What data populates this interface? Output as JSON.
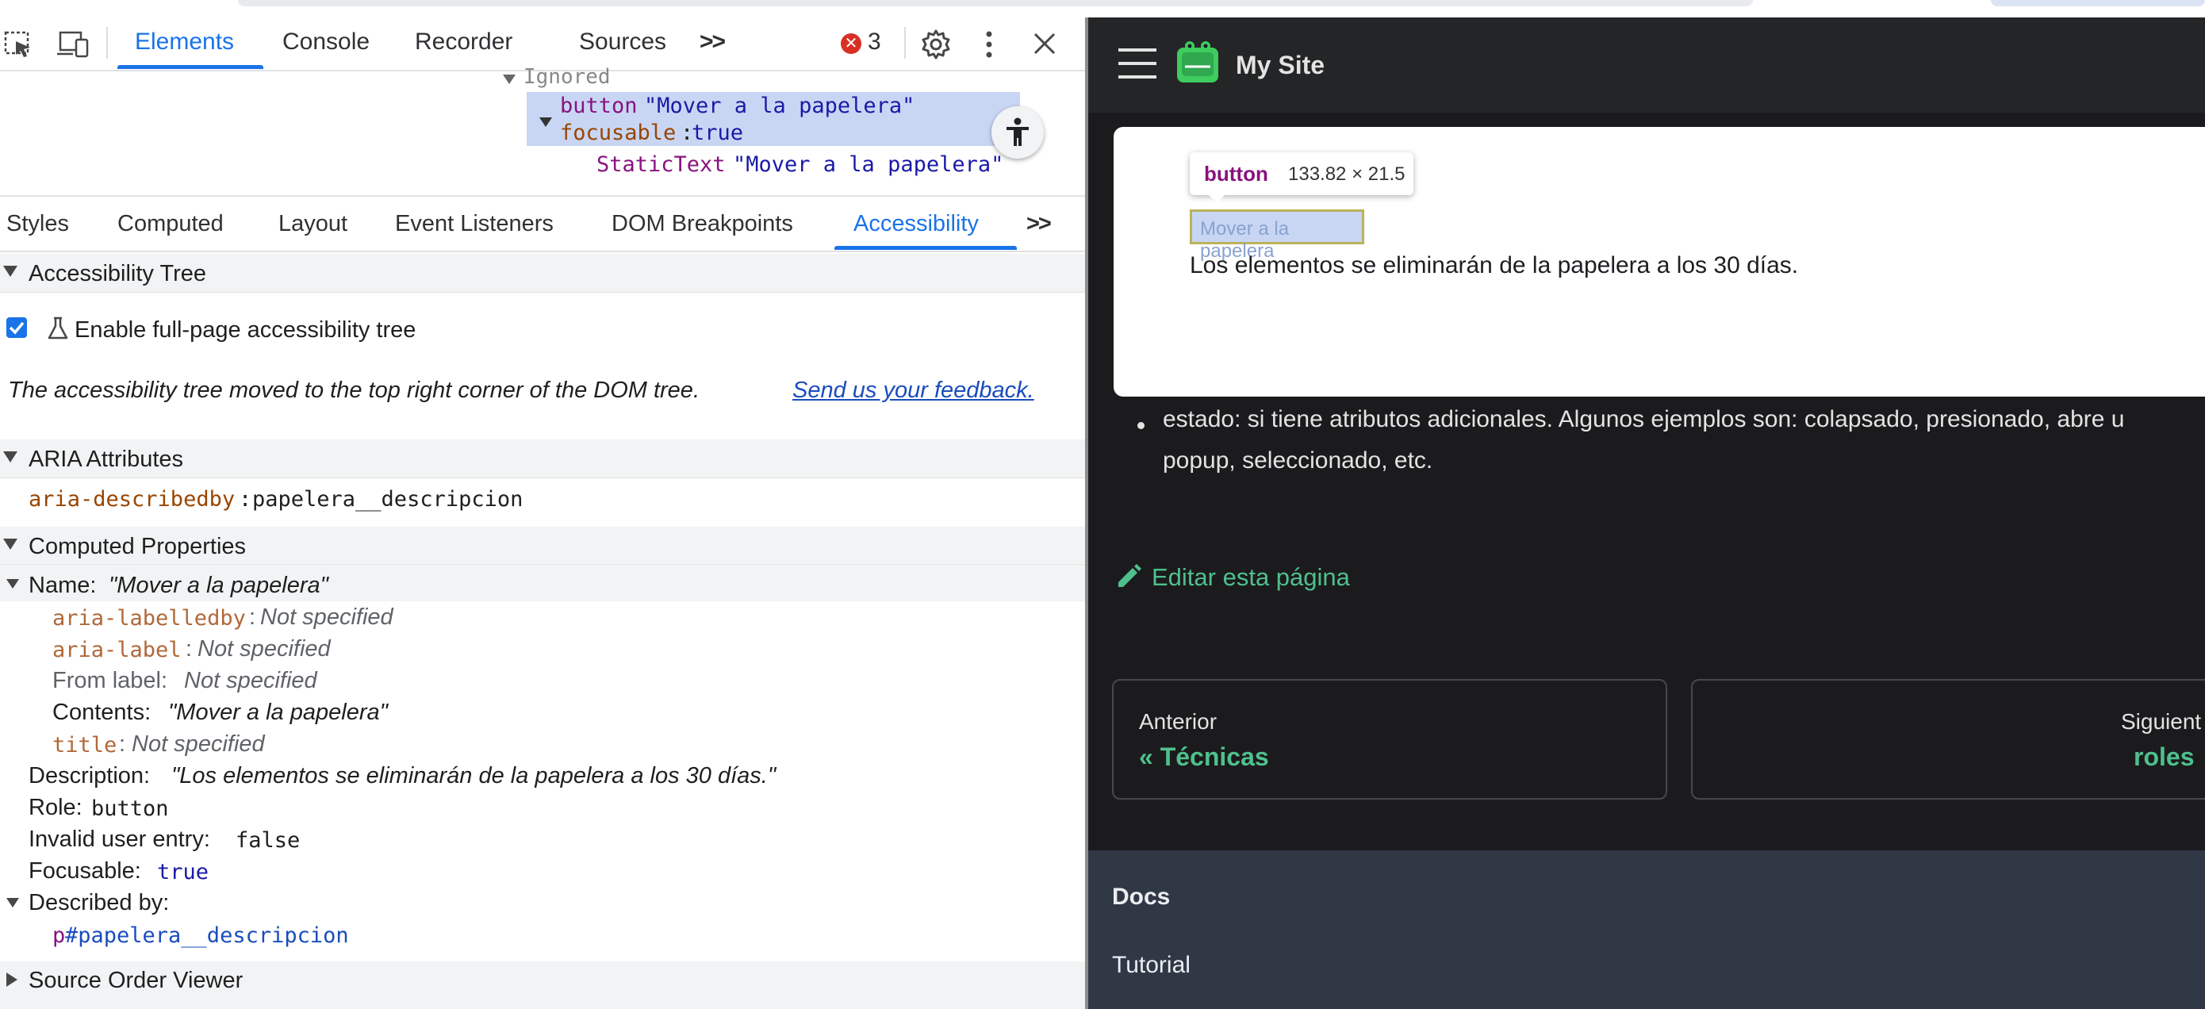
{
  "devtools": {
    "toolbar": {
      "tabs": [
        "Elements",
        "Console",
        "Recorder",
        "Sources"
      ],
      "more_label": ">>",
      "error_count": "3"
    },
    "dom": {
      "ignored": "Ignored",
      "button_role": "button",
      "button_name": "\"Mover a la papelera\"",
      "focusable_key": "focusable",
      "focusable_val": "true",
      "static_role": "StaticText",
      "static_name": "\"Mover a la papelera\""
    },
    "subtabs": [
      "Styles",
      "Computed",
      "Layout",
      "Event Listeners",
      "DOM Breakpoints",
      "Accessibility"
    ],
    "subtabs_more": ">>",
    "tree": {
      "title": "Accessibility Tree",
      "enable_label": "Enable full-page accessibility tree",
      "moved_notice": "The accessibility tree moved to the top right corner of the DOM tree.",
      "feedback_link": "Send us your feedback."
    },
    "aria": {
      "title": "ARIA Attributes",
      "attr_name": "aria-describedby",
      "attr_value": "papelera__descripcion"
    },
    "computed": {
      "title": "Computed Properties",
      "name_label": "Name:",
      "name_value": "\"Mover a la papelera\"",
      "labelledby_key": "aria-labelledby",
      "labelledby_val": "Not specified",
      "label_key": "aria-label",
      "label_val": "Not specified",
      "from_label_key": "From label:",
      "from_label_val": "Not specified",
      "contents_key": "Contents:",
      "contents_val": "\"Mover a la papelera\"",
      "title_key": "title",
      "title_val": "Not specified",
      "description_key": "Description:",
      "description_val": "\"Los elementos se eliminarán de la papelera a los 30 días.\"",
      "role_key": "Role:",
      "role_val": "button",
      "invalid_key": "Invalid user entry:",
      "invalid_val": "false",
      "focusable_key": "Focusable:",
      "focusable_val": "true",
      "described_by_key": "Described by:",
      "described_tag": "p",
      "described_id": "#papelera__descripcion"
    },
    "source_order": {
      "title": "Source Order Viewer"
    }
  },
  "site": {
    "title": "My Site",
    "tooltip_tag": "button",
    "tooltip_size": "133.82 × 21.5",
    "button_label": "Mover a la papelera",
    "description": "Los elementos se eliminarán de la papelera a los 30 días.",
    "bullet_line1": "estado: si tiene atributos adicionales. Algunos ejemplos son: colapsado, presionado, abre u",
    "bullet_line2": "popup, seleccionado, etc.",
    "edit_link": "Editar esta página",
    "prev_label": "Anterior",
    "prev_title": "« Técnicas",
    "next_label": "Siguient",
    "next_title": "roles",
    "footer_heading": "Docs",
    "footer_link": "Tutorial"
  },
  "colors": {
    "accent_blue": "#1a73e8",
    "site_link_green": "#4fc08d",
    "highlight": "#c8d6f4"
  }
}
